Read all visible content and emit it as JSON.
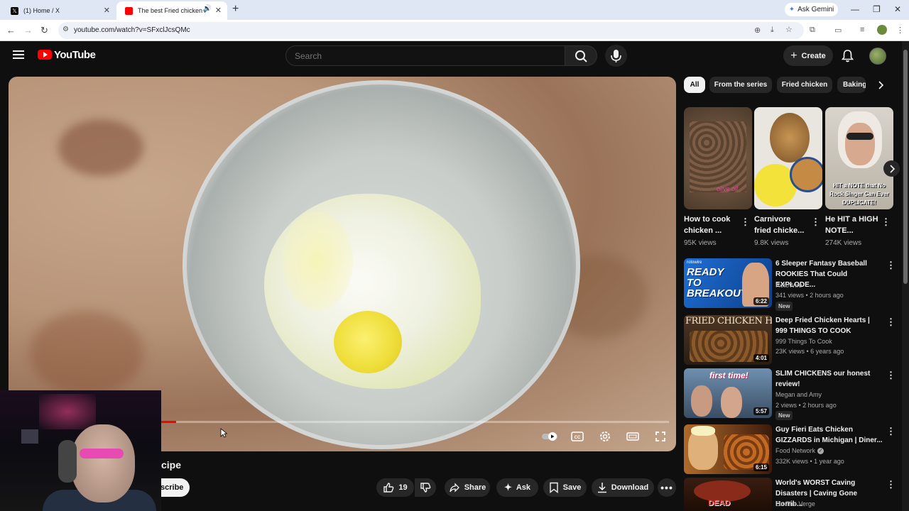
{
  "browser": {
    "tabs": [
      {
        "title": "(1) Home / X",
        "favicon_color": "#000000",
        "active": false
      },
      {
        "title": "The best Fried chicken hea",
        "favicon_color": "#ff0000",
        "active": true
      }
    ],
    "url": "youtube.com/watch?v=SFxclJcsQMc",
    "gemini_label": "Ask Gemini"
  },
  "youtube": {
    "logo_text": "YouTube",
    "search_placeholder": "Search",
    "create_label": "Create"
  },
  "player": {
    "progress": 0.03,
    "accent": "#ff0000"
  },
  "video": {
    "title_visible": "cipe",
    "subscribe_visible": "scribe",
    "like_count": "19",
    "share_label": "Share",
    "ask_label": "Ask",
    "save_label": "Save",
    "download_label": "Download"
  },
  "chips": [
    "All",
    "From the series",
    "Fried chicken",
    "Baking"
  ],
  "shorts": [
    {
      "title": "How to cook chicken ...",
      "views": "95K views",
      "thumb_text": "olive oil"
    },
    {
      "title": "Carnivore fried chicke...",
      "views": "9.8K views",
      "thumb_text": ""
    },
    {
      "title": "He HIT a HIGH NOTE...",
      "views": "274K views",
      "thumb_text": "HIT a NOTE that No Rock Singer Can Ever DUPLICATE!"
    }
  ],
  "related": [
    {
      "title": "6 Sleeper Fantasy Baseball ROOKIES That Could EXPLODE...",
      "channel": "RotoWire",
      "meta": "341 views • 2 hours ago",
      "duration": "6:22",
      "badge": "New",
      "thumb_text": "READY TO BREAKOUT",
      "thumb_label": "rotowire"
    },
    {
      "title": "Deep Fried Chicken Hearts | 999 THINGS TO COOK",
      "channel": "999 Things To Cook",
      "meta": "23K views • 6 years ago",
      "duration": "4:01",
      "badge": "",
      "thumb_text": "FRIED CHICKEN HEARTS"
    },
    {
      "title": "SLIM CHICKENS our honest review!",
      "channel": "Megan and Amy",
      "meta": "2 views • 2 hours ago",
      "duration": "5:57",
      "badge": "New",
      "thumb_text": "first time!"
    },
    {
      "title": "Guy Fieri Eats Chicken GIZZARDS in Michigan | Diner...",
      "channel": "Food Network",
      "meta": "332K views • 1 year ago",
      "duration": "6:15",
      "badge": "",
      "thumb_text": ""
    },
    {
      "title": "World's WORST Caving Disasters | Caving Gone Horrib...",
      "channel": "On The Verge",
      "meta": "",
      "duration": "",
      "badge": "",
      "thumb_text": "DEAD"
    }
  ]
}
